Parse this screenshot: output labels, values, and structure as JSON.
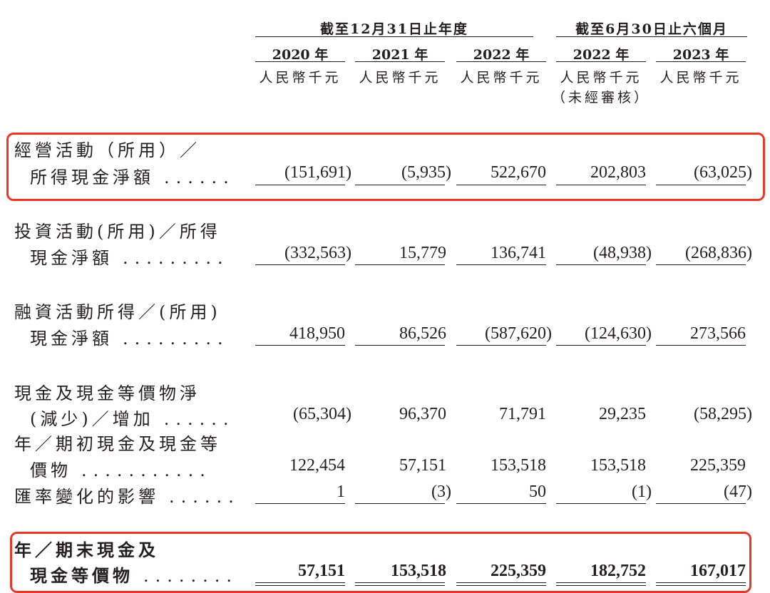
{
  "header": {
    "group1": "截至12月31日止年度",
    "group2": "截至6月30日止六個月",
    "years": [
      "2020 年",
      "2021 年",
      "2022 年",
      "2022 年",
      "2023 年"
    ],
    "units": [
      "人民幣千元",
      "人民幣千元",
      "人民幣千元",
      "人民幣千元",
      "人民幣千元"
    ],
    "unaudited": "（未經審核）"
  },
  "rows": [
    {
      "label1": "經營活動（所用）／",
      "label2": "所得現金淨額",
      "dots": "......",
      "values": [
        "(151,691)",
        "(5,935)",
        "522,670",
        "202,803",
        "(63,025)"
      ]
    },
    {
      "label1": "投資活動(所用)／所得",
      "label2": "現金淨額",
      "dots": ".........",
      "values": [
        "(332,563)",
        "15,779",
        "136,741",
        "(48,938)",
        "(268,836)"
      ]
    },
    {
      "label1": "融資活動所得／(所用)",
      "label2": "現金淨額",
      "dots": ".........",
      "values": [
        "418,950",
        "86,526",
        "(587,620)",
        "(124,630)",
        "273,566"
      ]
    },
    {
      "label1": "現金及現金等價物淨",
      "label2": "(減少)／增加",
      "dots": "......",
      "values": [
        "(65,304)",
        "96,370",
        "71,791",
        "29,235",
        "(58,295)"
      ]
    },
    {
      "label1": "年／期初現金及現金等",
      "label2": "價物",
      "dots": "...........",
      "values": [
        "122,454",
        "57,151",
        "153,518",
        "153,518",
        "225,359"
      ]
    },
    {
      "label1": "匯率變化的影響",
      "dots": "......",
      "values": [
        "1",
        "(3)",
        "50",
        "(1)",
        "(47)"
      ]
    },
    {
      "label1": "年／期末現金及",
      "label2": "現金等價物",
      "dots": "........",
      "values": [
        "57,151",
        "153,518",
        "225,359",
        "182,752",
        "167,017"
      ]
    }
  ]
}
